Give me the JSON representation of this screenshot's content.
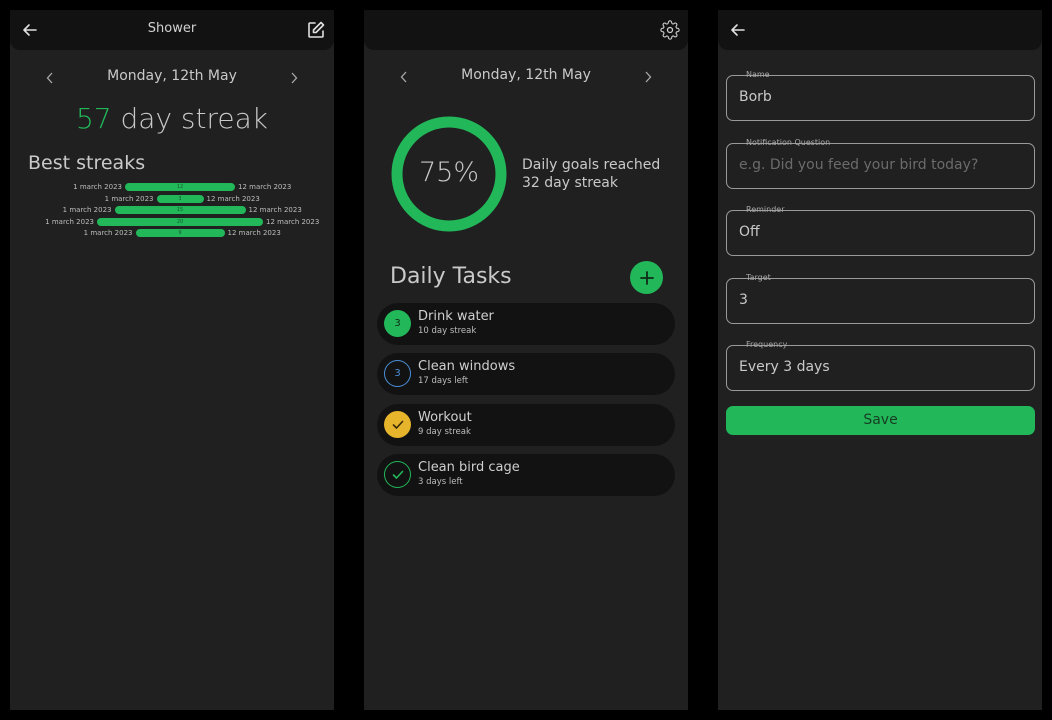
{
  "colors": {
    "accent": "#22b85a",
    "background": "#202020",
    "appbar": "#121212",
    "task_yellow": "#e6b52c",
    "task_blue": "#4a8fd6"
  },
  "streak_screen": {
    "title": "Shower",
    "back_icon": "arrow-left-icon",
    "edit_icon": "edit-icon",
    "date": "Monday, 12th May",
    "streak_number": "57",
    "streak_suffix": " day streak",
    "best_title": "Best streaks",
    "best_streaks": [
      {
        "start": "1 march 2023",
        "end": "12 march 2023",
        "days": 12,
        "label": "12"
      },
      {
        "start": "1 march 2023",
        "end": "12 march 2023",
        "days": 3,
        "label": "3"
      },
      {
        "start": "1 march 2023",
        "end": "12 march 2023",
        "days": 15,
        "label": "15"
      },
      {
        "start": "1 march 2023",
        "end": "12 march 2023",
        "days": 20,
        "label": "20"
      },
      {
        "start": "1 march 2023",
        "end": "12 march 2023",
        "days": 9,
        "label": "9"
      }
    ]
  },
  "home_screen": {
    "settings_icon": "gear-icon",
    "date": "Monday, 12th May",
    "progress_percent": 75,
    "progress_label": "75%",
    "goals_line1": "Daily goals reached",
    "goals_line2": "32 day streak",
    "tasks_title": "Daily Tasks",
    "add_icon": "plus-icon",
    "tasks": [
      {
        "name": "Drink water",
        "sub": "10 day streak",
        "badge": "3",
        "state": "filled-green"
      },
      {
        "name": "Clean windows",
        "sub": "17 days left",
        "badge": "3",
        "state": "outline-blue"
      },
      {
        "name": "Workout",
        "sub": "9 day streak",
        "badge": "check",
        "state": "filled-yellow"
      },
      {
        "name": "Clean bird cage",
        "sub": "3 days left",
        "badge": "check",
        "state": "outline-green"
      }
    ]
  },
  "edit_screen": {
    "back_icon": "arrow-left-icon",
    "fields": [
      {
        "label": "Name",
        "value": "Borb",
        "placeholder": ""
      },
      {
        "label": "Notification Question",
        "value": "",
        "placeholder": "e.g. Did you feed your bird today?"
      },
      {
        "label": "Reminder",
        "value": "Off",
        "placeholder": ""
      },
      {
        "label": "Target",
        "value": "3",
        "placeholder": ""
      },
      {
        "label": "Frequency",
        "value": "Every 3 days",
        "placeholder": ""
      }
    ],
    "save_label": "Save"
  }
}
